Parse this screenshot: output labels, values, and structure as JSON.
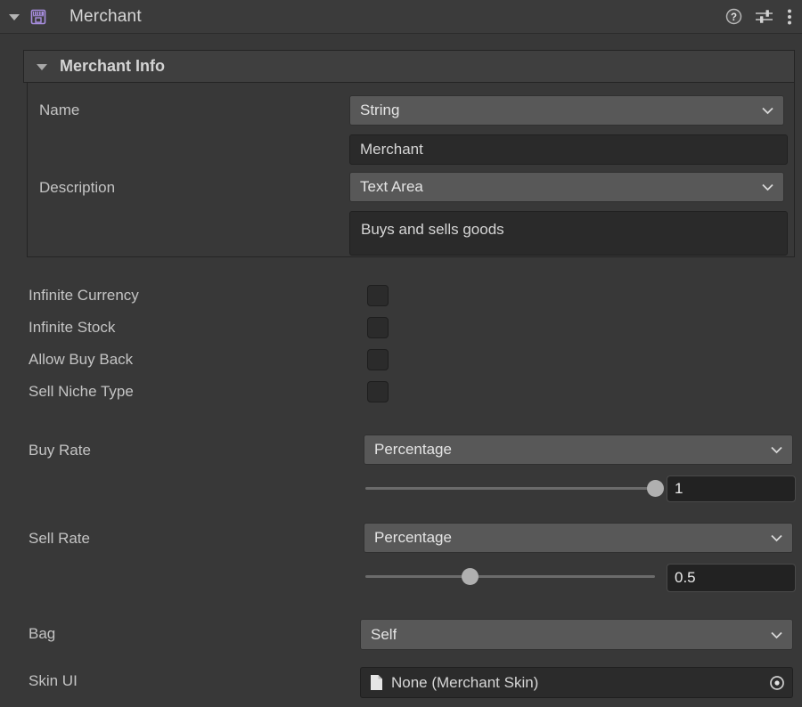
{
  "header": {
    "title": "Merchant",
    "component_icon": "store-icon",
    "foldout_arrow": "triangle-down-icon",
    "icons": [
      {
        "name": "help-icon",
        "label": "?"
      },
      {
        "name": "preset-icon",
        "label": ""
      },
      {
        "name": "more-menu-icon",
        "label": ""
      }
    ]
  },
  "merchant_info": {
    "title": "Merchant Info",
    "expanded": true,
    "rows": [
      {
        "label": "Name",
        "type_dropdown": "String",
        "value": "Merchant",
        "value_kind": "text"
      },
      {
        "label": "Description",
        "type_dropdown": "Text Area",
        "value": "Buys and sells goods",
        "value_kind": "textarea"
      }
    ]
  },
  "toggles": [
    {
      "label": "Infinite Currency",
      "checked": false
    },
    {
      "label": "Infinite Stock",
      "checked": false
    },
    {
      "label": "Allow Buy Back",
      "checked": false
    },
    {
      "label": "Sell Niche Type",
      "checked": false
    }
  ],
  "rates": [
    {
      "label": "Buy Rate",
      "mode": "Percentage",
      "value": "1",
      "slider_percent": 100
    },
    {
      "label": "Sell Rate",
      "mode": "Percentage",
      "value": "0.5",
      "slider_percent": 36
    }
  ],
  "bag": {
    "label": "Bag",
    "value": "Self"
  },
  "skin_ui": {
    "label": "Skin UI",
    "value": "None (Merchant Skin)",
    "file_icon": "script-file-icon",
    "picker_icon": "object-picker-icon"
  },
  "colors": {
    "background": "#383838",
    "accent": "#a88ee0",
    "dropdown": "#585858",
    "field": "#2a2a2a",
    "text": "#c9c9c9"
  }
}
